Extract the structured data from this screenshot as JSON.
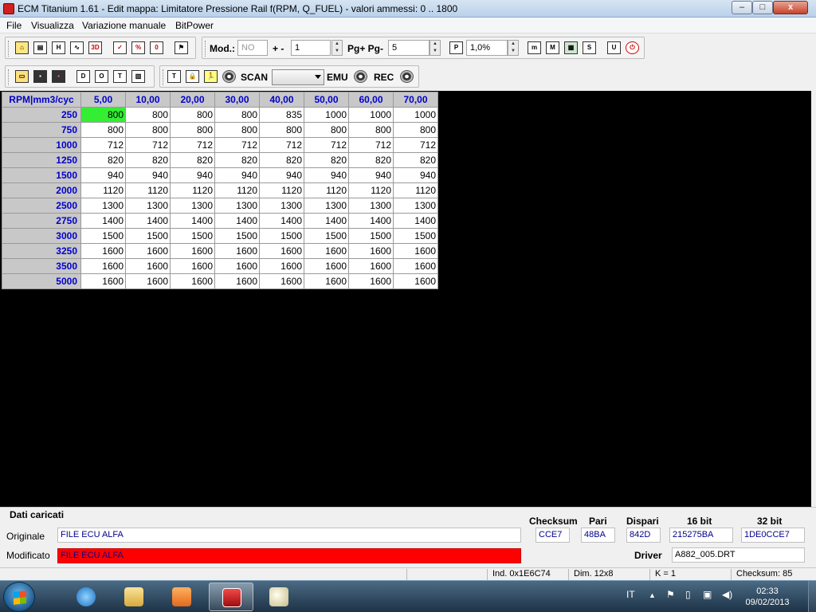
{
  "window": {
    "title": "ECM Titanium 1.61 - Edit mappa: Limitatore Pressione Rail f(RPM, Q_FUEL) - valori ammessi: 0 .. 1800",
    "minimize_glyph": "–",
    "maximize_glyph": "□",
    "close_glyph": "x"
  },
  "menu": [
    "File",
    "Visualizza",
    "Variazione manuale",
    "BitPower"
  ],
  "toolbar1": {
    "mod_label": "Mod.:",
    "mod_value": "NO",
    "plusminus_label": "+ -",
    "plusminus_value": "1",
    "pg_label": "Pg+ Pg-",
    "pg_value": "5",
    "percent_value": "1,0%",
    "icons_left": [
      "home-icon",
      "copy-map-icon",
      "hex-view-icon",
      "graph-icon",
      "3d-view-icon",
      "check-icon",
      "calc-icon",
      "zero-icon",
      "flag-icon"
    ],
    "icons_right": [
      "m-icon",
      "M-icon",
      "map-icon",
      "s-icon",
      "u-icon",
      "power-icon"
    ]
  },
  "toolbar2": {
    "scan_label": "SCAN",
    "scan_value": "",
    "emu_label": "EMU",
    "rec_label": "REC",
    "icons_left": [
      "open-folder-icon",
      "save-icon",
      "save-as-icon",
      "d-icon",
      "o-icon",
      "t-icon",
      "panel-icon"
    ],
    "icons_mid": [
      "t-tool-icon",
      "lock-icon",
      "runner-icon",
      "record-dot-icon"
    ]
  },
  "map": {
    "corner": "RPM|mm3/cyc",
    "columns": [
      "5,00",
      "10,00",
      "20,00",
      "30,00",
      "40,00",
      "50,00",
      "60,00",
      "70,00"
    ],
    "rows": [
      {
        "rpm": "250",
        "values": [
          "800",
          "800",
          "800",
          "800",
          "835",
          "1000",
          "1000",
          "1000"
        ]
      },
      {
        "rpm": "750",
        "values": [
          "800",
          "800",
          "800",
          "800",
          "800",
          "800",
          "800",
          "800"
        ]
      },
      {
        "rpm": "1000",
        "values": [
          "712",
          "712",
          "712",
          "712",
          "712",
          "712",
          "712",
          "712"
        ]
      },
      {
        "rpm": "1250",
        "values": [
          "820",
          "820",
          "820",
          "820",
          "820",
          "820",
          "820",
          "820"
        ]
      },
      {
        "rpm": "1500",
        "values": [
          "940",
          "940",
          "940",
          "940",
          "940",
          "940",
          "940",
          "940"
        ]
      },
      {
        "rpm": "2000",
        "values": [
          "1120",
          "1120",
          "1120",
          "1120",
          "1120",
          "1120",
          "1120",
          "1120"
        ]
      },
      {
        "rpm": "2500",
        "values": [
          "1300",
          "1300",
          "1300",
          "1300",
          "1300",
          "1300",
          "1300",
          "1300"
        ]
      },
      {
        "rpm": "2750",
        "values": [
          "1400",
          "1400",
          "1400",
          "1400",
          "1400",
          "1400",
          "1400",
          "1400"
        ]
      },
      {
        "rpm": "3000",
        "values": [
          "1500",
          "1500",
          "1500",
          "1500",
          "1500",
          "1500",
          "1500",
          "1500"
        ]
      },
      {
        "rpm": "3250",
        "values": [
          "1600",
          "1600",
          "1600",
          "1600",
          "1600",
          "1600",
          "1600",
          "1600"
        ]
      },
      {
        "rpm": "3500",
        "values": [
          "1600",
          "1600",
          "1600",
          "1600",
          "1600",
          "1600",
          "1600",
          "1600"
        ]
      },
      {
        "rpm": "5000",
        "values": [
          "1600",
          "1600",
          "1600",
          "1600",
          "1600",
          "1600",
          "1600",
          "1600"
        ]
      }
    ],
    "selected_cell": {
      "row": 0,
      "col": 0
    }
  },
  "info": {
    "section_title": "Dati caricati",
    "originale_label": "Originale",
    "originale_value": "FILE ECU ALFA",
    "modificato_label": "Modificato",
    "modificato_value": "FILE ECU ALFA",
    "checksum_header": "Checksum",
    "pari_header": "Pari",
    "dispari_header": "Dispari",
    "bit16_header": "16 bit",
    "bit32_header": "32 bit",
    "checksum_value": "CCE7",
    "pari_value": "48BA",
    "dispari_value": "842D",
    "bit16_value": "215275BA",
    "bit32_value": "1DE0CCE7",
    "driver_label": "Driver",
    "driver_value": "A882_005.DRT"
  },
  "status": {
    "ind": "Ind. 0x1E6C74",
    "dim": "Dim. 12x8",
    "k": "K = 1",
    "checksum": "Checksum: 85"
  },
  "taskbar": {
    "lang": "IT",
    "time": "02:33",
    "date": "09/02/2013"
  },
  "colors": {
    "header_text": "#0000cc",
    "selected_cell": "#33ee33",
    "modified_field": "#ff0000"
  }
}
